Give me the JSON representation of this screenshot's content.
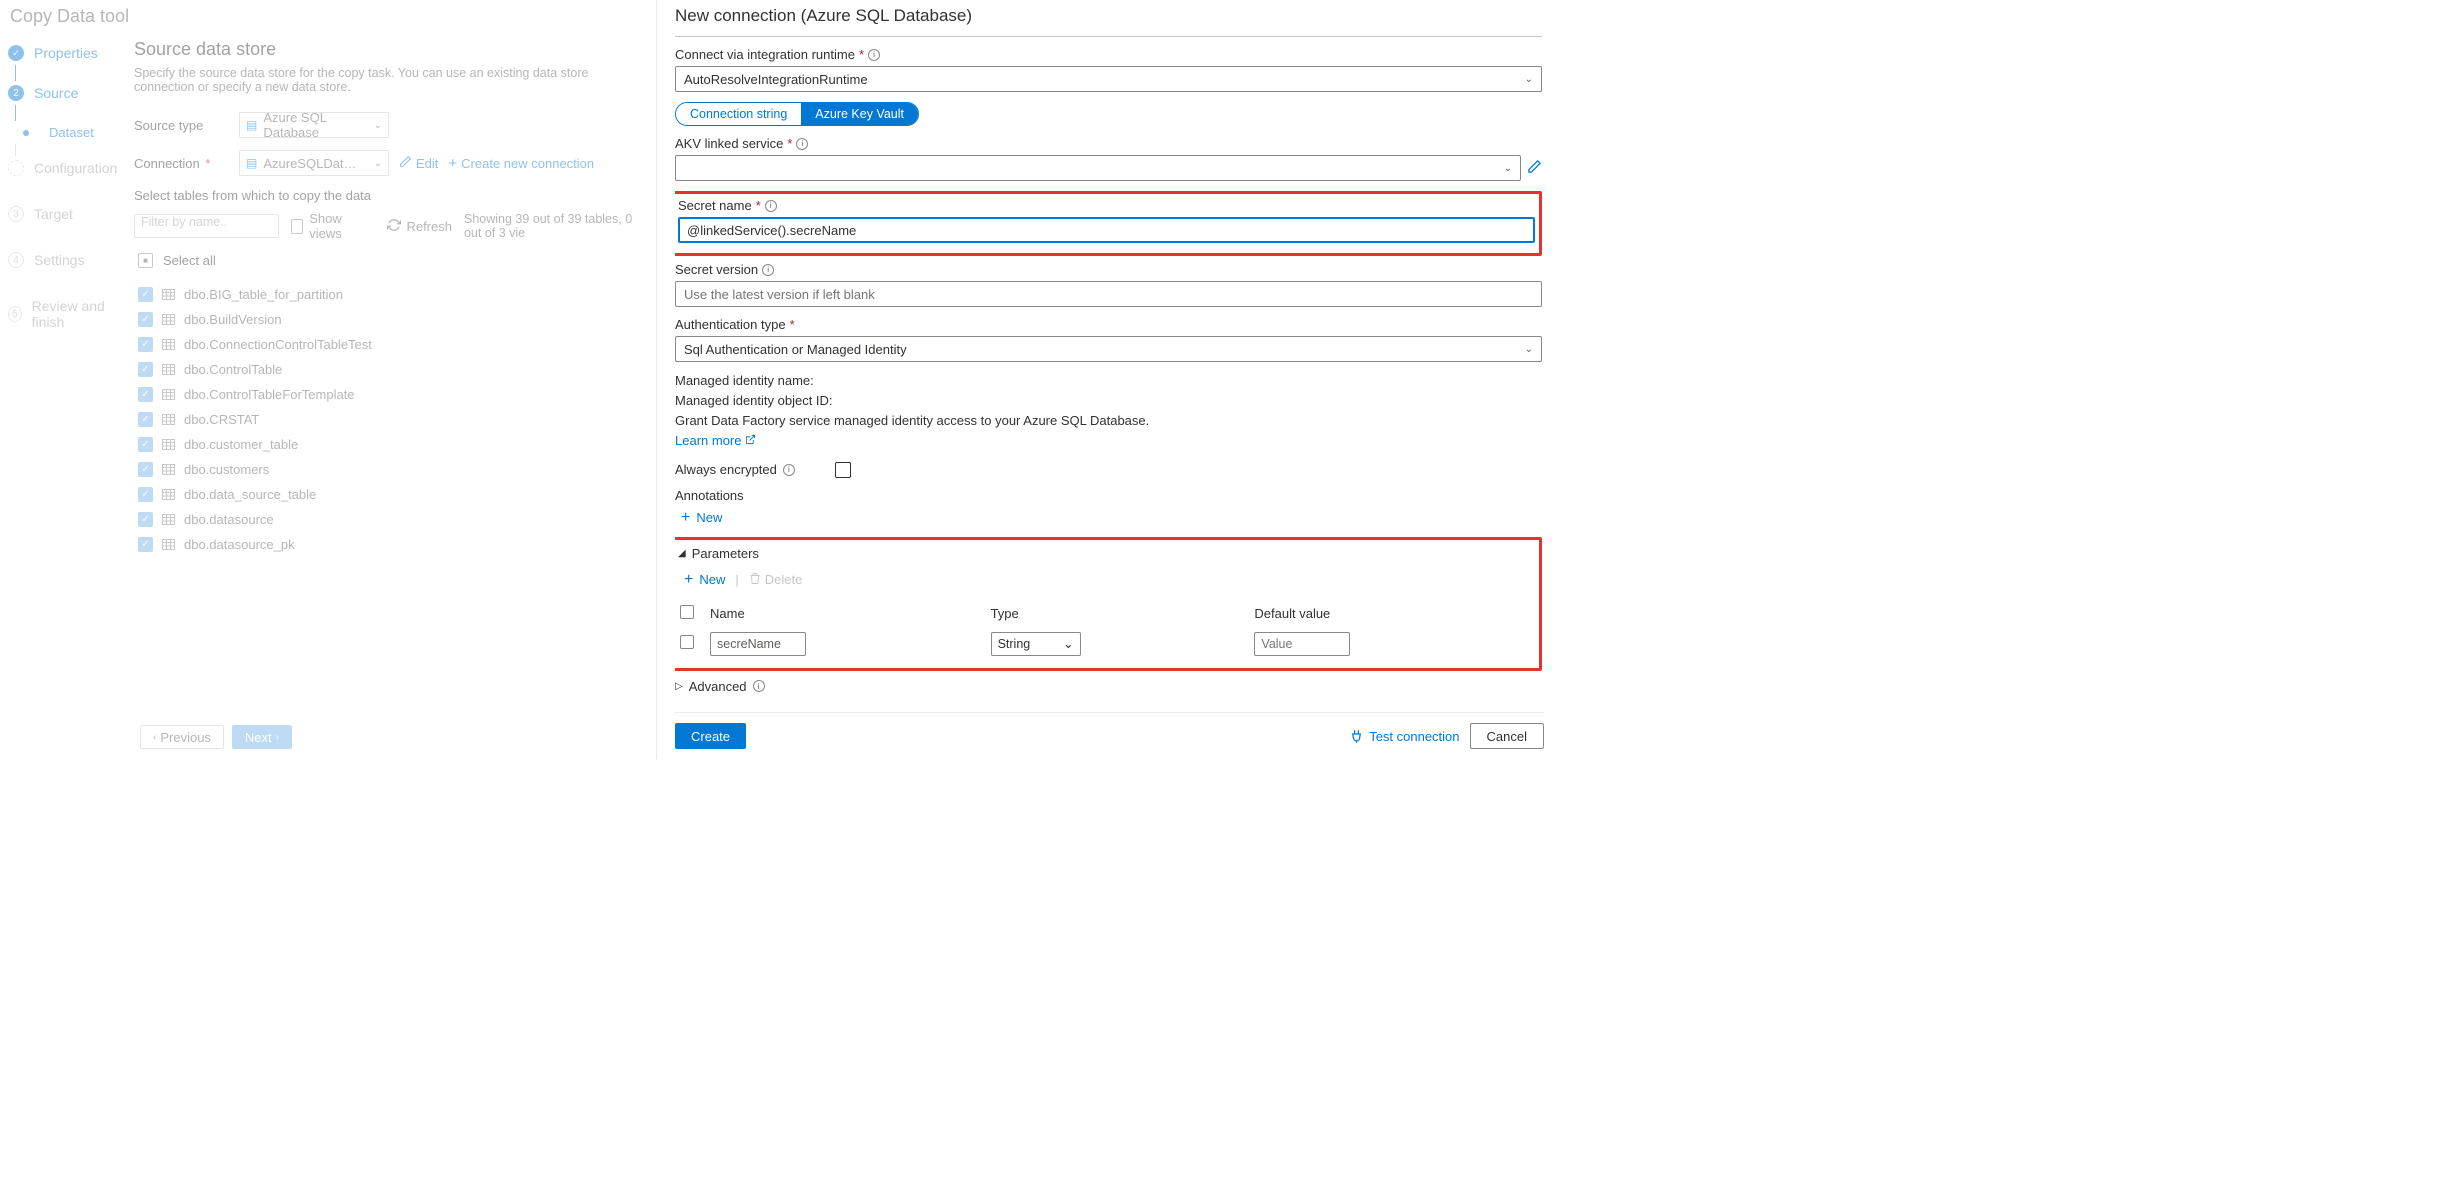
{
  "header": {
    "title": "Copy Data tool"
  },
  "wizard": {
    "steps": [
      {
        "label": "Properties",
        "state": "done"
      },
      {
        "label": "Source",
        "state": "active"
      },
      {
        "label": "Dataset",
        "state": "sub"
      },
      {
        "label": "Configuration",
        "state": "pending",
        "num": ""
      },
      {
        "label": "Target",
        "state": "pending",
        "num": "3"
      },
      {
        "label": "Settings",
        "state": "pending",
        "num": "4"
      },
      {
        "label": "Review and finish",
        "state": "pending",
        "num": "5"
      }
    ]
  },
  "main": {
    "title": "Source data store",
    "subtitle": "Specify the source data store for the copy task. You can use an existing data store connection or specify a new data store.",
    "sourceTypeLabel": "Source type",
    "sourceTypeValue": "Azure SQL Database",
    "connectionLabel": "Connection",
    "connectionValue": "AzureSQLDatabaseLinkedService",
    "editLabel": "Edit",
    "createNewLabel": "Create new connection",
    "selectTablesLabel": "Select tables from which to copy the data",
    "filterPlaceholder": "Filter by name..",
    "showViewsLabel": "Show views",
    "refreshLabel": "Refresh",
    "statusText": "Showing 39 out of 39 tables, 0 out of 3 vie",
    "selectAllLabel": "Select all",
    "tables": [
      "dbo.BIG_table_for_partition",
      "dbo.BuildVersion",
      "dbo.ConnectionControlTableTest",
      "dbo.ControlTable",
      "dbo.ControlTableForTemplate",
      "dbo.CRSTAT",
      "dbo.customer_table",
      "dbo.customers",
      "dbo.data_source_table",
      "dbo.datasource",
      "dbo.datasource_pk"
    ],
    "prevLabel": "Previous",
    "nextLabel": "Next"
  },
  "panel": {
    "title": "New connection (Azure SQL Database)",
    "irLabel": "Connect via integration runtime",
    "irValue": "AutoResolveIntegrationRuntime",
    "tabConnStr": "Connection string",
    "tabAkv": "Azure Key Vault",
    "akvLabel": "AKV linked service",
    "secretNameLabel": "Secret name",
    "secretNameValue": "@linkedService().secreName",
    "secretVersionLabel": "Secret version",
    "secretVersionPlaceholder": "Use the latest version if left blank",
    "authTypeLabel": "Authentication type",
    "authTypeValue": "Sql Authentication or Managed Identity",
    "miName": "Managed identity name:",
    "miObjId": "Managed identity object ID:",
    "miGrant": "Grant Data Factory service managed identity access to your Azure SQL Database.",
    "learnMore": "Learn more",
    "alwaysEncLabel": "Always encrypted",
    "annotationsLabel": "Annotations",
    "newLabel": "New",
    "parametersLabel": "Parameters",
    "deleteLabel": "Delete",
    "colName": "Name",
    "colType": "Type",
    "colDefault": "Default value",
    "paramName": "secreName",
    "paramType": "String",
    "paramValuePlaceholder": "Value",
    "advancedLabel": "Advanced",
    "createBtn": "Create",
    "testConnLabel": "Test connection",
    "cancelBtn": "Cancel"
  }
}
